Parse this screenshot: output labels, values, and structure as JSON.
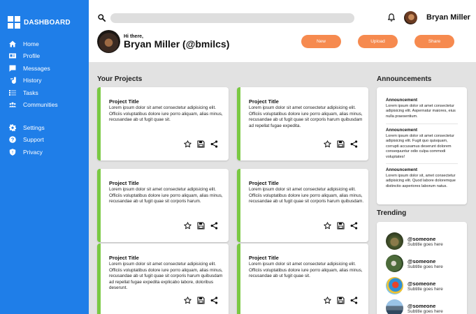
{
  "brand": {
    "title": "DASHBOARD"
  },
  "nav": {
    "items": [
      {
        "label": "Home",
        "icon": "home-icon"
      },
      {
        "label": "Profile",
        "icon": "profile-card-icon"
      },
      {
        "label": "Messages",
        "icon": "message-icon"
      },
      {
        "label": "History",
        "icon": "history-icon"
      },
      {
        "label": "Tasks",
        "icon": "tasks-icon"
      },
      {
        "label": "Communities",
        "icon": "people-icon"
      }
    ],
    "secondary": [
      {
        "label": "Settings",
        "icon": "gear-icon"
      },
      {
        "label": "Support",
        "icon": "help-icon"
      },
      {
        "label": "Privacy",
        "icon": "shield-icon"
      }
    ]
  },
  "header": {
    "search_placeholder": "",
    "user_name": "Bryan Miller",
    "greeting": "Hi there,",
    "greeting_name": "Bryan Miller (@bmilcs)",
    "buttons": {
      "new": "New",
      "upload": "Upload",
      "share": "Share"
    }
  },
  "projects": {
    "title": "Your Projects",
    "cards": [
      {
        "title": "Project Title",
        "body": "Lorem ipsum dolor sit amet consectetur adipisicing elit. Officiis voluptatibus dolore iure porro aliquam, alias minus, recusandae ab ut fugit quae sit."
      },
      {
        "title": "Project Title",
        "body": "Lorem ipsum dolor sit amet consectetur adipisicing elit. Officiis voluptatibus dolore iure porro aliquam, alias minus, recusandae ab ut fugit quae sit corporis harum quibusdam ad repellat fugae expedita."
      },
      {
        "title": "Project Title",
        "body": "Lorem ipsum dolor sit amet consectetur adipisicing elit. Officiis voluptatibus dolore iure porro aliquam, alias minus, recusandae ab ut fugit quae sit corporis harum."
      },
      {
        "title": "Project Title",
        "body": "Lorem ipsum dolor sit amet consectetur adipisicing elit. Officiis voluptatibus dolore iure porro aliquam, alias minus, recusandae ab ut fugit quae sit corporis harum quibusdam."
      },
      {
        "title": "Project Title",
        "body": "Lorem ipsum dolor sit amet consectetur adipisicing elit. Officiis voluptatibus dolore iure porro aliquam, alias minus, recusandae ab ut fugit quae sit corporis harum quibusdam ad repellat fugae expedita explicabo labore, doloribus deserunt."
      },
      {
        "title": "Project Title",
        "body": "Lorem ipsum dolor sit amet consectetur adipisicing elit. Officiis voluptatibus dolore iure porro aliquam, alias minus, recusandae ab ut fugit quae sit."
      }
    ]
  },
  "announcements": {
    "title": "Announcements",
    "items": [
      {
        "title": "Announcement",
        "body": "Lorem ipsum dolor sit amet consectetur adipisicing elit. Aspernatur maiores, eius nulla praesentium."
      },
      {
        "title": "Announcement",
        "body": "Lorem ipsum dolor sit amet consectetur adipisicing elit. Fugit quo quisquam, corrupti accusamus deserunt dolorem consequuntur odio culpa commodi voluptates!"
      },
      {
        "title": "Announcement",
        "body": "Lorem ipsum dolor sit, amet consectetur adipisicing elit. Quod labore doloremque distinctio asperiores laborum natus."
      }
    ]
  },
  "trending": {
    "title": "Trending",
    "items": [
      {
        "name": "@someone",
        "subtitle": "Subtitle goes here"
      },
      {
        "name": "@someone",
        "subtitle": "Subtitle goes here"
      },
      {
        "name": "@someone",
        "subtitle": "Subtitle goes here"
      },
      {
        "name": "@someone",
        "subtitle": "Subtitle goes here"
      }
    ]
  },
  "colors": {
    "sidebar": "#1f7ee8",
    "accent_button": "#f68a4f",
    "card_border": "#7ac943",
    "background": "#e2e2e2"
  }
}
